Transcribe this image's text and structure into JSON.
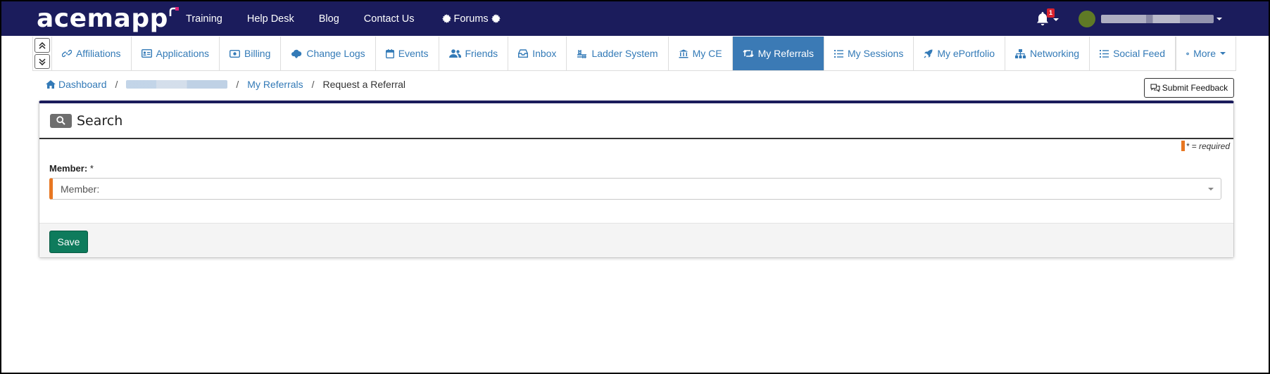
{
  "brand": {
    "name": "acemapp",
    "accent": "#e0257b",
    "navy": "#1b1c5c"
  },
  "topnav": {
    "items": [
      {
        "label": "Training"
      },
      {
        "label": "Help Desk"
      },
      {
        "label": "Blog"
      },
      {
        "label": "Contact Us"
      },
      {
        "label": "Forums",
        "icon": "gear-icon"
      }
    ],
    "notifications": {
      "count": "1",
      "icon": "bell-icon"
    },
    "user": {
      "icon": "avatar"
    }
  },
  "secnav": {
    "tabs": [
      {
        "label": "Affiliations",
        "icon": "link-icon"
      },
      {
        "label": "Applications",
        "icon": "id-card-icon"
      },
      {
        "label": "Billing",
        "icon": "money-icon"
      },
      {
        "label": "Change Logs",
        "icon": "cloud-icon"
      },
      {
        "label": "Events",
        "icon": "calendar-icon"
      },
      {
        "label": "Friends",
        "icon": "users-icon"
      },
      {
        "label": "Inbox",
        "icon": "inbox-icon"
      },
      {
        "label": "Ladder System",
        "icon": "ladder-icon"
      },
      {
        "label": "My CE",
        "icon": "institution-icon"
      },
      {
        "label": "My Referrals",
        "icon": "retweet-icon",
        "active": true
      },
      {
        "label": "My Sessions",
        "icon": "list-icon"
      },
      {
        "label": "My ePortfolio",
        "icon": "rocket-icon"
      },
      {
        "label": "Networking",
        "icon": "sitemap-icon"
      },
      {
        "label": "Social Feed",
        "icon": "list-icon"
      }
    ],
    "more_label": "More",
    "active_color": "#3b7ab5"
  },
  "breadcrumb": {
    "home": "Dashboard",
    "middle": "My Referrals",
    "current": "Request a Referral"
  },
  "feedback": {
    "label": "Submit Feedback"
  },
  "panel": {
    "title": "Search",
    "required_note": "* = required",
    "member_label": "Member:",
    "member_required": "*",
    "member_placeholder": "Member:",
    "save_label": "Save",
    "required_color": "#e87722",
    "save_color": "#0e7b5c"
  }
}
